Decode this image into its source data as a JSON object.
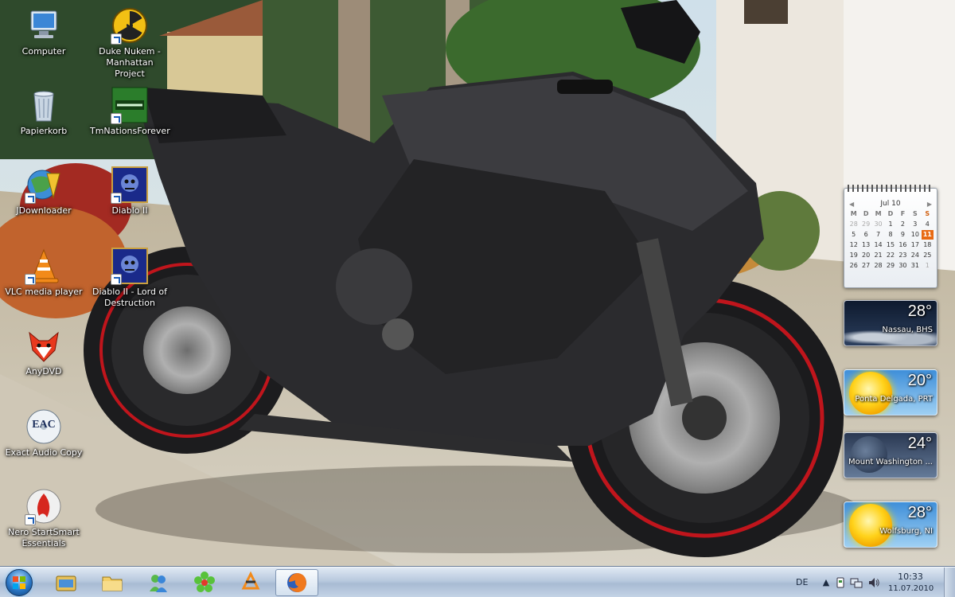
{
  "desktop": {
    "icons": [
      {
        "label": "Computer",
        "icon": "computer-icon",
        "shortcut": false
      },
      {
        "label": "Duke Nukem - Manhattan Project",
        "icon": "radiation-icon",
        "shortcut": true
      },
      {
        "label": "Papierkorb",
        "icon": "recycle-bin-icon",
        "shortcut": false
      },
      {
        "label": "TmNationsForever",
        "icon": "tmnations-icon",
        "shortcut": true
      },
      {
        "label": "JDownloader",
        "icon": "jdownloader-icon",
        "shortcut": true
      },
      {
        "label": "Diablo II",
        "icon": "diablo-icon",
        "shortcut": true
      },
      {
        "label": "VLC media player",
        "icon": "vlc-cone-icon",
        "shortcut": true
      },
      {
        "label": "Diablo II - Lord of Destruction",
        "icon": "diablo-lod-icon",
        "shortcut": true
      },
      {
        "label": "AnyDVD",
        "icon": "fox-icon",
        "shortcut": false
      },
      {
        "label": "Exact Audio Copy",
        "icon": "eac-icon",
        "shortcut": false
      },
      {
        "label": "Nero StartSmart Essentials",
        "icon": "nero-icon",
        "shortcut": true
      }
    ],
    "eac_badge": "EAC"
  },
  "calendar": {
    "month": "Jul 10",
    "days_of_week": [
      "M",
      "D",
      "M",
      "D",
      "F",
      "S",
      "S"
    ],
    "weeks": [
      [
        "28",
        "29",
        "30",
        "1",
        "2",
        "3",
        "4"
      ],
      [
        "5",
        "6",
        "7",
        "8",
        "9",
        "10",
        "11"
      ],
      [
        "12",
        "13",
        "14",
        "15",
        "16",
        "17",
        "18"
      ],
      [
        "19",
        "20",
        "21",
        "22",
        "23",
        "24",
        "25"
      ],
      [
        "26",
        "27",
        "28",
        "29",
        "30",
        "31",
        "1"
      ]
    ],
    "today": "11",
    "prev_icon": "chevron-left-icon",
    "next_icon": "chevron-right-icon"
  },
  "weather": [
    {
      "temp": "28°",
      "city": "Nassau, BHS",
      "condition": "night-cloudy"
    },
    {
      "temp": "20°",
      "city": "Ponta Delgada, PRT",
      "condition": "sunny"
    },
    {
      "temp": "24°",
      "city": "Mount Washington ...",
      "condition": "moon"
    },
    {
      "temp": "28°",
      "city": "Wolfsburg, NI",
      "condition": "sunny"
    }
  ],
  "taskbar": {
    "start_icon": "windows-logo-icon",
    "pinned": [
      {
        "name": "windows-explorer-icon"
      },
      {
        "name": "folder-icon"
      },
      {
        "name": "messenger-icon"
      },
      {
        "name": "icq-flower-icon"
      },
      {
        "name": "winamp-icon"
      },
      {
        "name": "firefox-icon"
      }
    ],
    "language": "DE",
    "tray_icons": [
      "arrow-up-icon",
      "safely-remove-icon",
      "network-icon",
      "volume-icon"
    ],
    "clock_time": "10:33",
    "clock_date": "11.07.2010"
  }
}
